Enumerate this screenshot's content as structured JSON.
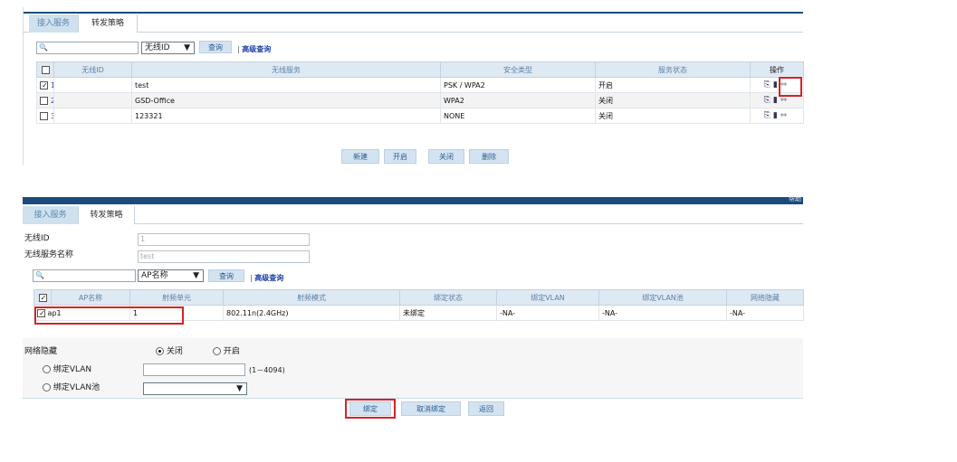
{
  "top": {
    "tabs": [
      "接入服务",
      "转发策略"
    ],
    "search": {
      "value": "",
      "filter": "无线ID",
      "query": "查询",
      "advanced": "高级查询"
    },
    "columns": [
      "无线ID",
      "无线服务",
      "安全类型",
      "服务状态",
      "操作"
    ],
    "rows": [
      {
        "id": "1",
        "service": "test",
        "security": "PSK / WPA2",
        "status": "开启",
        "checked": true
      },
      {
        "id": "2",
        "service": "GSD-Office",
        "security": "WPA2",
        "status": "关闭",
        "checked": false
      },
      {
        "id": "3",
        "service": "123321",
        "security": "NONE",
        "status": "关闭",
        "checked": false
      }
    ],
    "actions": [
      "新建",
      "开启",
      "关闭",
      "删除"
    ]
  },
  "bottom": {
    "header_text": "帮助",
    "tabs": [
      "接入服务",
      "转发策略"
    ],
    "fields": {
      "wireless_id_label": "无线ID",
      "wireless_id_value": "1",
      "service_name_label": "无线服务名称",
      "service_name_value": "test"
    },
    "search": {
      "value": "",
      "filter": "AP名称",
      "query": "查询",
      "advanced": "高级查询"
    },
    "columns": [
      "AP名称",
      "射频单元",
      "射频模式",
      "绑定状态",
      "绑定VLAN",
      "绑定VLAN池",
      "网络隐藏"
    ],
    "row": {
      "ap": "ap1",
      "radio": "1",
      "mode": "802.11n(2.4GHz)",
      "bind_status": "未绑定",
      "vlan": "-NA-",
      "vlan_pool": "-NA-",
      "hidden": "-NA-"
    },
    "form": {
      "hide_label": "网络隐藏",
      "off": "关闭",
      "on": "开启",
      "vlan_label": "绑定VLAN",
      "vlan_range": "(1－4094)",
      "pool_label": "绑定VLAN池"
    },
    "actions": [
      "绑定",
      "取消绑定",
      "返回"
    ]
  },
  "colors": {
    "header_bar": "#1c4a7d",
    "tab_active": "#cfe0ee",
    "highlight": "#d32424"
  }
}
